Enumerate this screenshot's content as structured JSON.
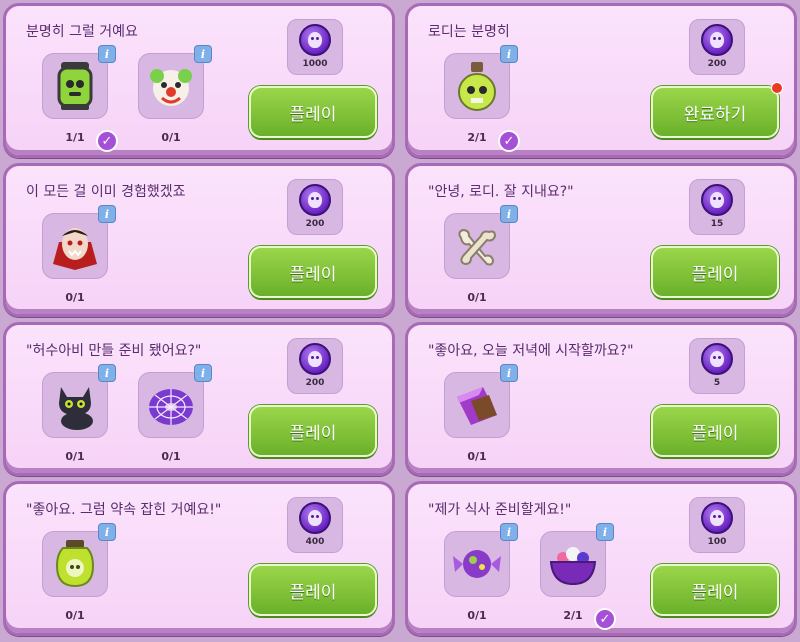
{
  "colors": {
    "card_bg": "#f8dbf9",
    "card_border": "#a86ab6",
    "button_green": "#7cc23a",
    "coin_purple": "#6a22c4",
    "info_blue": "#7fb1e8",
    "check_purple": "#a64fd8",
    "notify_red": "#e83a24"
  },
  "quests": [
    {
      "title": "분명히 그럴 거예요",
      "reward": "1000",
      "button": "플레이",
      "items": [
        {
          "icon": "green-monster-jar-icon",
          "count": "1/1",
          "completed": true
        },
        {
          "icon": "clown-mask-icon",
          "count": "0/1",
          "completed": false
        }
      ]
    },
    {
      "title": "로디는 분명히",
      "reward": "200",
      "button": "완료하기",
      "notification": true,
      "items": [
        {
          "icon": "skull-potion-icon",
          "count": "2/1",
          "completed": true
        }
      ]
    },
    {
      "title": "이 모든 걸 이미 경험했겠죠",
      "reward": "200",
      "button": "플레이",
      "items": [
        {
          "icon": "vampire-mask-icon",
          "count": "0/1",
          "completed": false
        }
      ]
    },
    {
      "title": "\"안녕, 로디. 잘 지내요?\"",
      "reward": "15",
      "button": "플레이",
      "items": [
        {
          "icon": "bone-icon",
          "count": "0/1",
          "completed": false
        }
      ]
    },
    {
      "title": "\"허수아비 만들 준비 됐어요?\"",
      "reward": "200",
      "button": "플레이",
      "items": [
        {
          "icon": "black-cat-icon",
          "count": "0/1",
          "completed": false
        },
        {
          "icon": "spiderweb-donut-icon",
          "count": "0/1",
          "completed": false
        }
      ]
    },
    {
      "title": "\"좋아요, 오늘 저녁에 시작할까요?\"",
      "reward": "5",
      "button": "플레이",
      "items": [
        {
          "icon": "candy-bar-icon",
          "count": "0/1",
          "completed": false
        }
      ]
    },
    {
      "title": "\"좋아요. 그럼 약속 잡힌 거예요!\"",
      "reward": "400",
      "button": "플레이",
      "items": [
        {
          "icon": "skull-jar-icon",
          "count": "0/1",
          "completed": false
        }
      ]
    },
    {
      "title": "\"제가 식사 준비할게요!\"",
      "reward": "100",
      "button": "플레이",
      "items": [
        {
          "icon": "wrapped-candy-icon",
          "count": "0/1",
          "completed": false
        },
        {
          "icon": "candy-bowl-icon",
          "count": "2/1",
          "completed": true
        }
      ]
    }
  ]
}
